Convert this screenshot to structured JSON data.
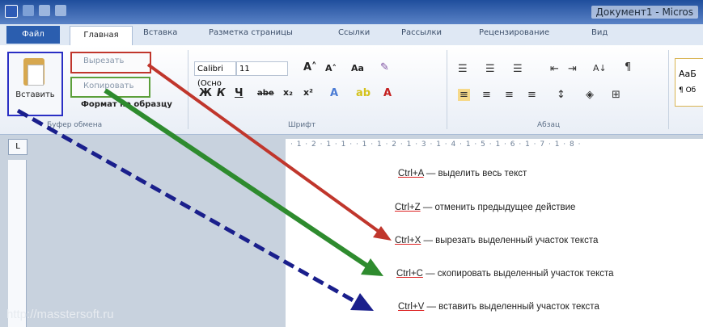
{
  "window": {
    "title": "Документ1 - Micros"
  },
  "ribbon_tabs": {
    "file": "Файл",
    "home": "Главная",
    "insert": "Вставка",
    "layout": "Разметка страницы",
    "refs": "Ссылки",
    "mailings": "Рассылки",
    "review": "Рецензирование",
    "view": "Вид"
  },
  "clipboard": {
    "paste": "Вставить",
    "cut": "Вырезать",
    "copy": "Копировать",
    "format": "Формат по образцу",
    "group": "Буфер обмена"
  },
  "font": {
    "name": "Calibri (Осно",
    "size": "11",
    "group": "Шрифт"
  },
  "paragraph": {
    "group": "Абзац"
  },
  "styles": {
    "sample1": "AaБ",
    "sample2": "¶ Об"
  },
  "shortcuts": [
    {
      "key": "Ctrl+A",
      "text": " — выделить весь текст"
    },
    {
      "key": "Ctrl+Z",
      "text": " — отменить предыдущее действие"
    },
    {
      "key": "Ctrl+X",
      "text": " — вырезать выделенный участок текста"
    },
    {
      "key": "Ctrl+C",
      "text": " — скопировать выделенный участок текста"
    },
    {
      "key": "Ctrl+V",
      "text": " — вставить выделенный участок текста"
    }
  ],
  "watermark": "http://masstersoft.ru",
  "colors": {
    "cut_arrow": "#c0362c",
    "copy_arrow": "#2e8b2e",
    "paste_arrow": "#1a1f8c"
  },
  "ruler": {
    "ticks": "· 1 · 2 · 1 · 1 · · 1 · 1 · 2 · 1 · 3 · 1 · 4 · 1 · 5 · 1 · 6 · 1 · 7 · 1 · 8 ·"
  }
}
